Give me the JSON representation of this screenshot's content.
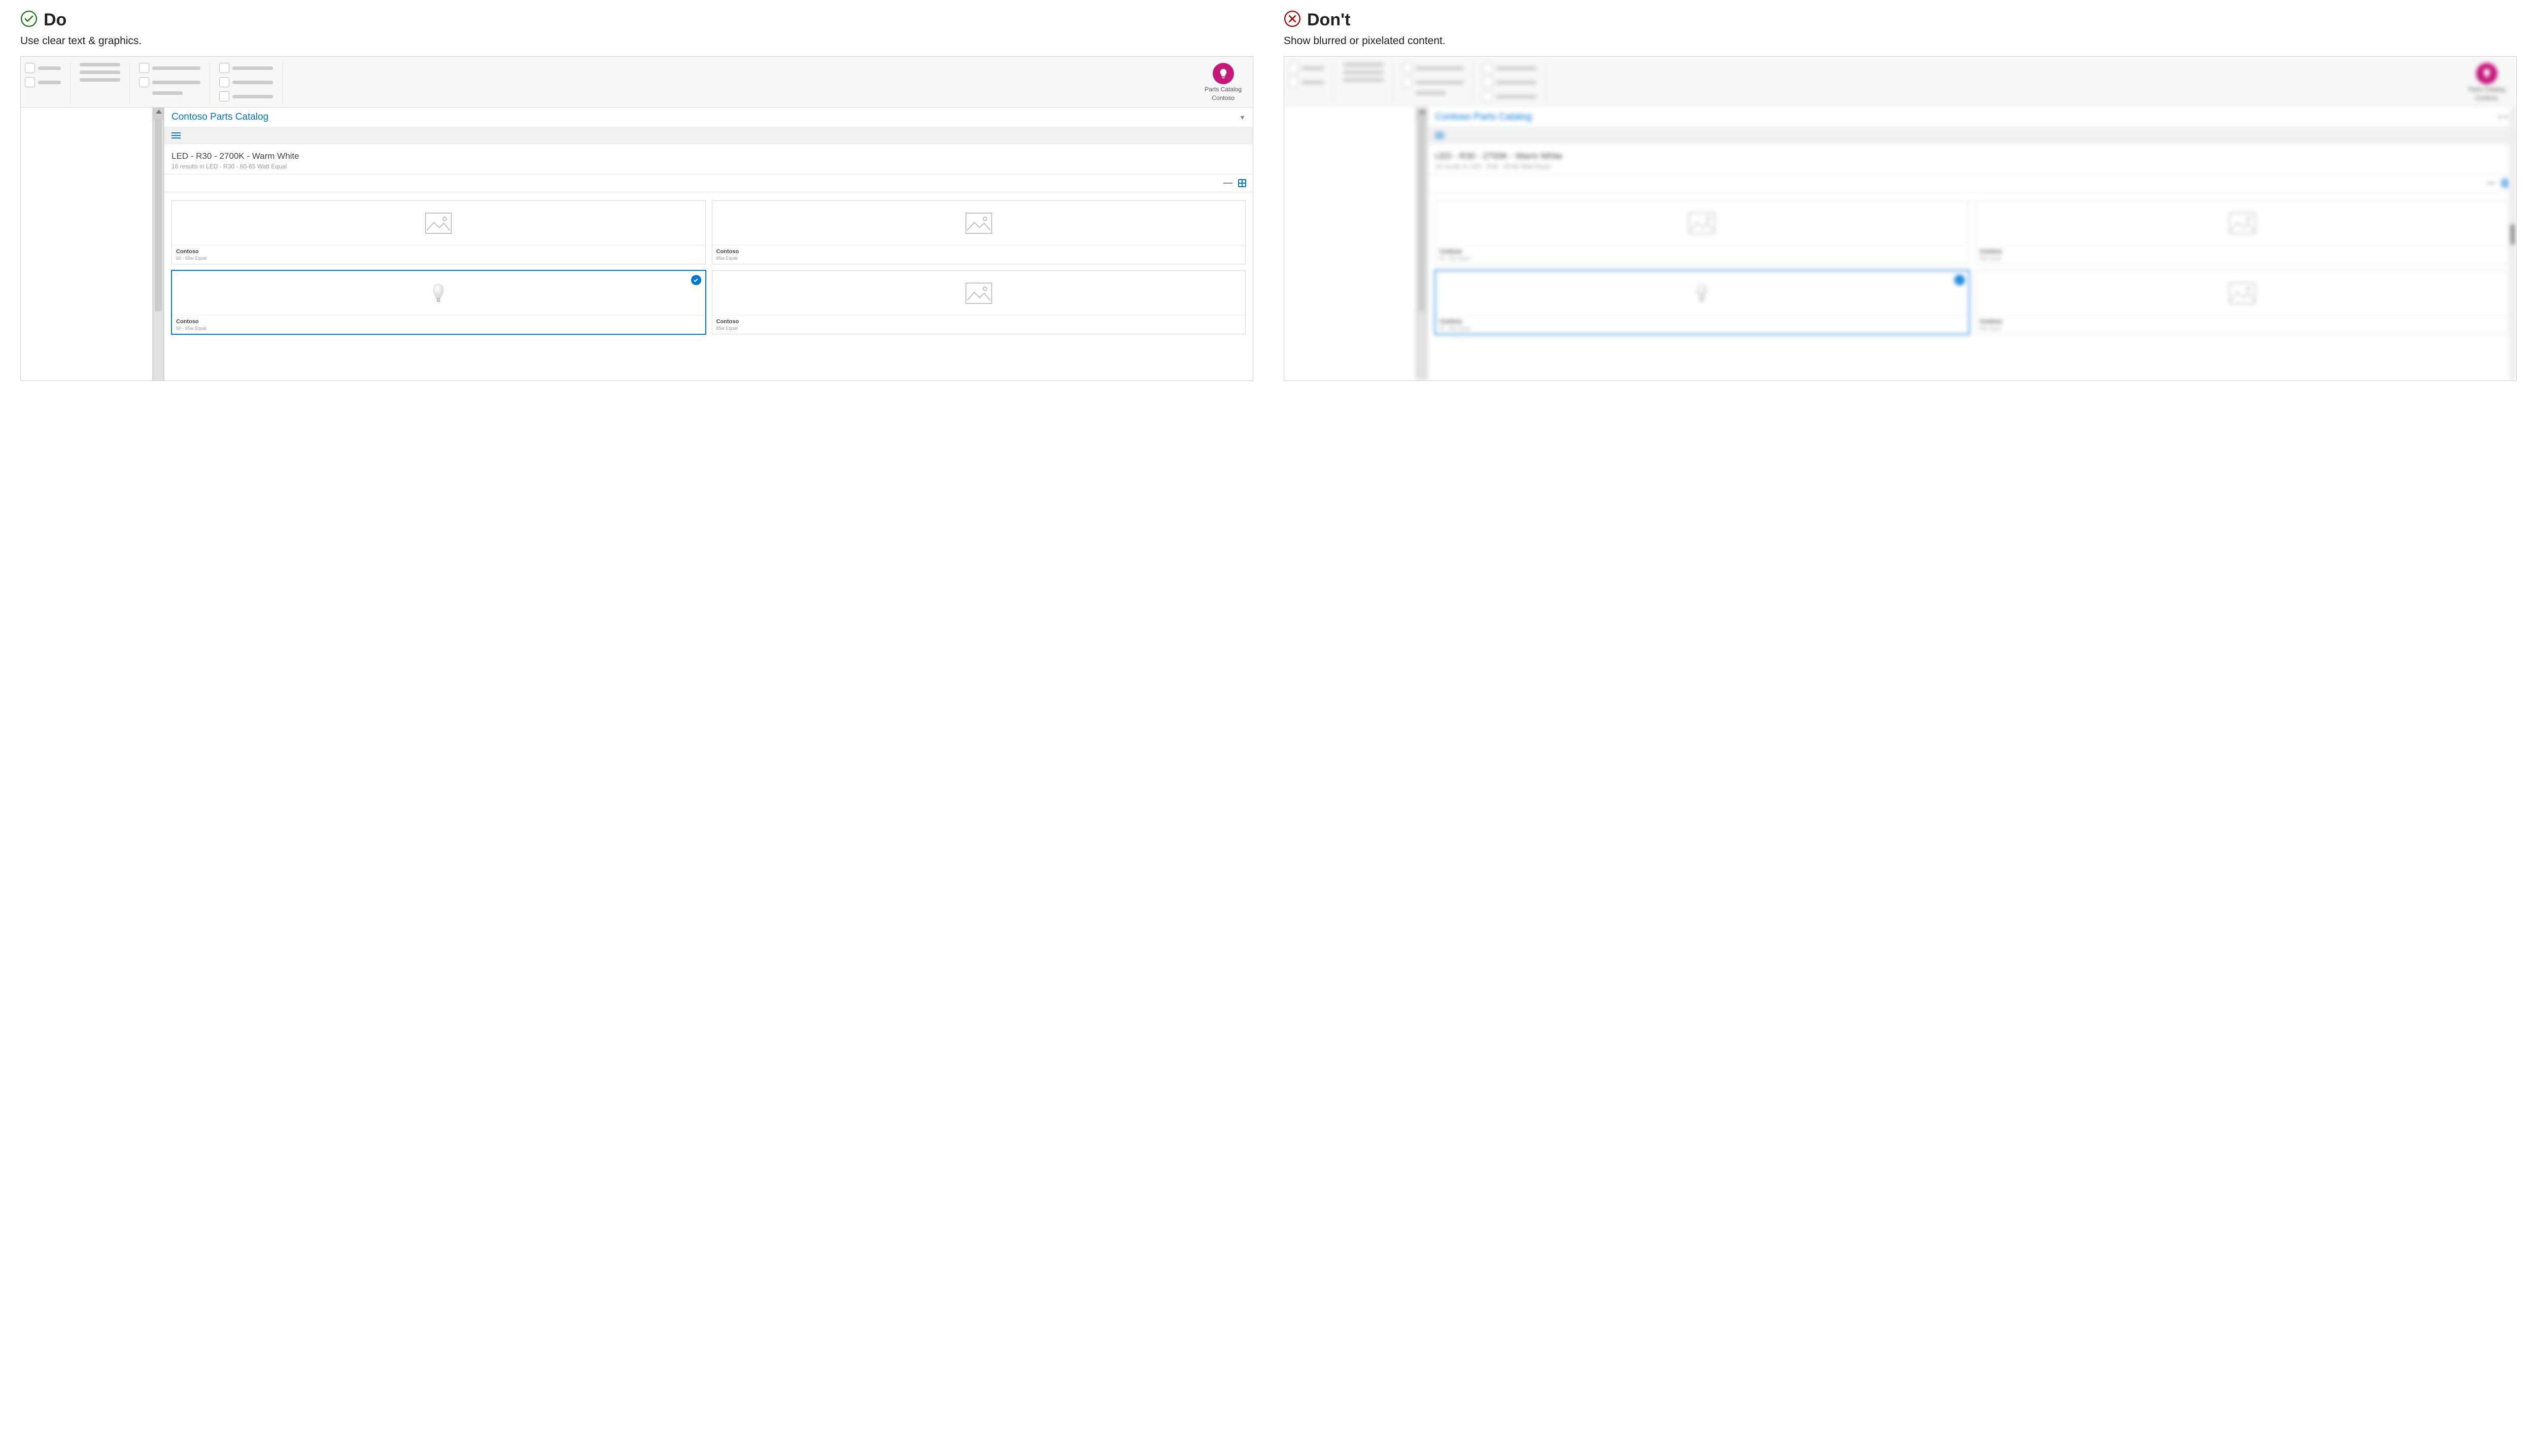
{
  "do": {
    "title": "Do",
    "subtitle": "Use clear text & graphics."
  },
  "dont": {
    "title": "Don't",
    "subtitle": "Show blurred or pixelated content."
  },
  "addin": {
    "line1": "Parts Catalog",
    "line2": "Contoso"
  },
  "pane": {
    "title": "Contoso Parts Catalog",
    "query_title": "LED - R30 - 2700K - Warm White",
    "query_sub": "16 results in LED - R30 - 60-65 Watt Equal"
  },
  "cards": [
    {
      "brand": "Contoso",
      "spec": "60 - 65w Equal",
      "selected": false,
      "placeholder": true
    },
    {
      "brand": "Contoso",
      "spec": "85w Equal",
      "selected": false,
      "placeholder": true
    },
    {
      "brand": "Contoso",
      "spec": "60 - 65w Equal",
      "selected": true,
      "placeholder": false
    },
    {
      "brand": "Contoso",
      "spec": "85w Equal",
      "selected": false,
      "placeholder": true
    }
  ]
}
